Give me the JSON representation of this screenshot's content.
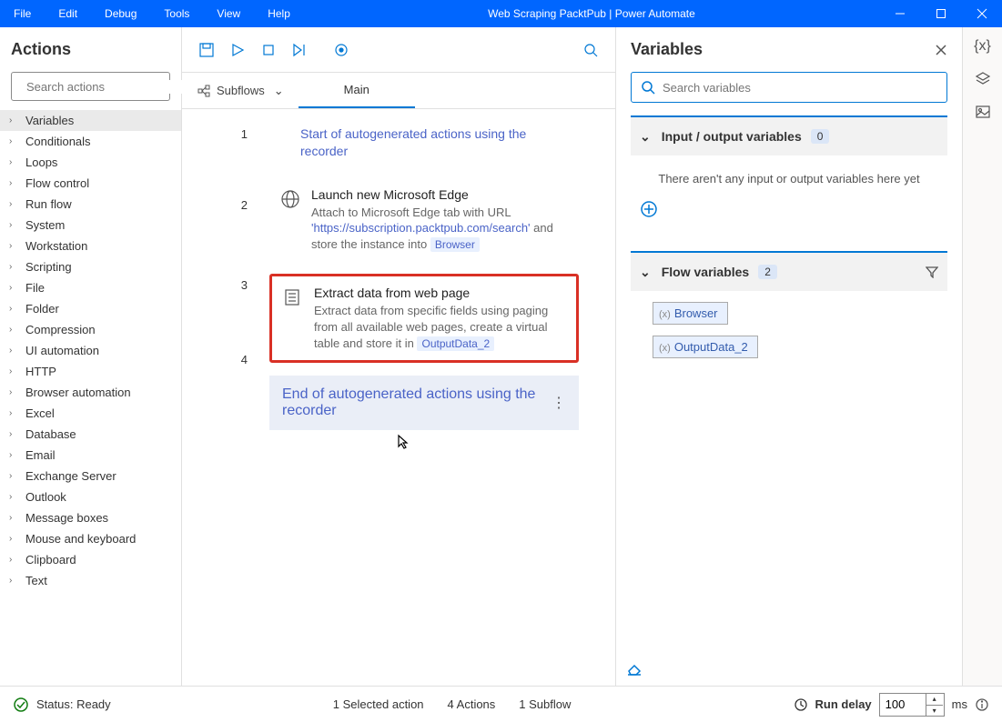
{
  "title": "Web Scraping PacktPub | Power Automate",
  "menus": {
    "file": "File",
    "edit": "Edit",
    "debug": "Debug",
    "tools": "Tools",
    "view": "View",
    "help": "Help"
  },
  "actions": {
    "title": "Actions",
    "search_placeholder": "Search actions",
    "items": [
      "Variables",
      "Conditionals",
      "Loops",
      "Flow control",
      "Run flow",
      "System",
      "Workstation",
      "Scripting",
      "File",
      "Folder",
      "Compression",
      "UI automation",
      "HTTP",
      "Browser automation",
      "Excel",
      "Database",
      "Email",
      "Exchange Server",
      "Outlook",
      "Message boxes",
      "Mouse and keyboard",
      "Clipboard",
      "Text"
    ]
  },
  "subflows_label": "Subflows",
  "tab_main": "Main",
  "steps": {
    "comment_start": "Start of autogenerated actions using the recorder",
    "s2": {
      "title": "Launch new Microsoft Edge",
      "desc1": "Attach to Microsoft Edge tab with URL",
      "url": "'https://subscription.packtpub.com/search'",
      "desc2": "and store the instance into",
      "var": "Browser"
    },
    "s3": {
      "title": "Extract data from web page",
      "desc1": "Extract data from specific fields using paging from all available web pages, create a virtual table and store it in",
      "var": "OutputData_2"
    },
    "comment_end": "End of autogenerated actions using the recorder"
  },
  "variables": {
    "title": "Variables",
    "search_placeholder": "Search variables",
    "io_title": "Input / output variables",
    "io_count": "0",
    "io_empty": "There aren't any input or output variables here yet",
    "flow_title": "Flow variables",
    "flow_count": "2",
    "items": {
      "v1": "Browser",
      "v2": "OutputData_2"
    }
  },
  "status": {
    "ready": "Status: Ready",
    "selected": "1 Selected action",
    "actions": "4 Actions",
    "subflow": "1 Subflow",
    "rundelay": "Run delay",
    "delay_value": "100",
    "ms": "ms"
  }
}
